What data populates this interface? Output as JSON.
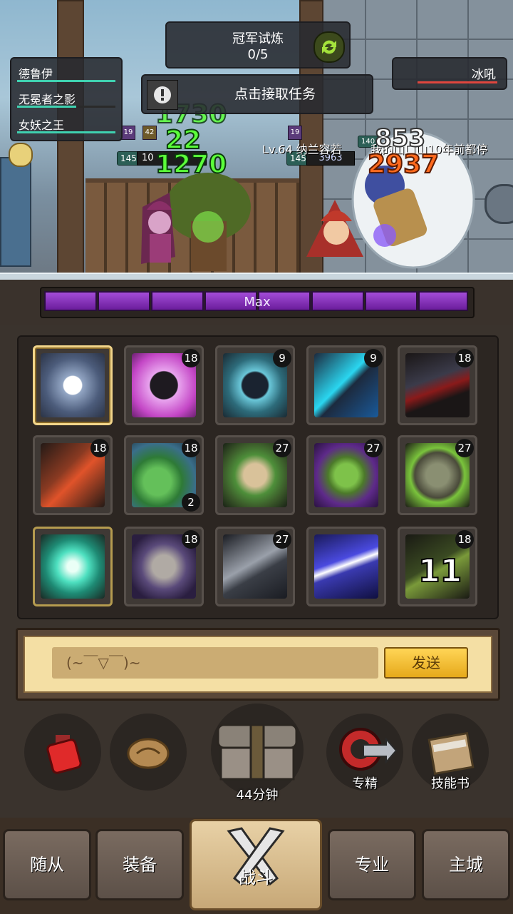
{
  "trial": {
    "title": "冠军试炼",
    "progress": "0/5"
  },
  "quest": {
    "label": "点击接取任务"
  },
  "party": [
    {
      "name": "德鲁伊",
      "hp_fraction": 0.95
    },
    {
      "name": "无冕者之影",
      "hp_fraction": 0.6
    },
    {
      "name": "女妖之王",
      "hp_fraction": 0.95
    }
  ],
  "enemy": {
    "name": "冰吼",
    "hp_fraction": 0.85
  },
  "damage_numbers": {
    "green": [
      "1730",
      "22",
      "1270"
    ],
    "orange": [
      "853",
      "2937"
    ]
  },
  "scene_text": {
    "left_level": "145",
    "left_hp": "10",
    "buff_a": "19",
    "buff_b": "42",
    "right_level": "145",
    "right_hp": "3963",
    "right_buff": "140",
    "right_buff2": "19",
    "player_tag": "Lv.64 纳兰容若",
    "chat_bubble": "我的山口山10年前都停"
  },
  "maxbar": {
    "label": "Max",
    "segments": 8
  },
  "skills": [
    {
      "name": "frost-nova-icon",
      "count": null,
      "selected": true
    },
    {
      "name": "bear-paw-icon",
      "count": "18"
    },
    {
      "name": "ice-ring-icon",
      "count": "9"
    },
    {
      "name": "lightning-shield-icon",
      "count": "9"
    },
    {
      "name": "claw-slash-icon",
      "count": "18"
    },
    {
      "name": "dragon-roar-icon",
      "count": "18"
    },
    {
      "name": "leaf-icon",
      "count": "18",
      "count_bottom": "2"
    },
    {
      "name": "entangling-fist-icon",
      "count": "27"
    },
    {
      "name": "nature-burst-icon",
      "count": "27"
    },
    {
      "name": "skull-totem-icon",
      "count": "27"
    },
    {
      "name": "emerald-eye-icon",
      "count": null,
      "selected_alt": true
    },
    {
      "name": "stone-shard-icon",
      "count": "18"
    },
    {
      "name": "meteor-strike-icon",
      "count": "27"
    },
    {
      "name": "chain-lightning-icon",
      "count": null
    },
    {
      "name": "thorn-cooldown-icon",
      "count": "18",
      "cooldown": "11"
    }
  ],
  "chat": {
    "input_value": "(~￣▽￣)~",
    "send_label": "发送"
  },
  "actions": {
    "potion": "potion-icon",
    "bread": "bread-icon",
    "chest_timer": "44分钟",
    "elite_label": "专精",
    "skillbook_label": "技能书"
  },
  "tabs": [
    "随从",
    "装备",
    "战斗",
    "专业",
    "主城"
  ],
  "colors": {
    "hp_teal": "#3fd1b0",
    "enemy_red": "#e0463e",
    "max_purple": "#9a3fd0",
    "damage_green": "#5bff3a",
    "damage_orange": "#ff6a1e"
  }
}
